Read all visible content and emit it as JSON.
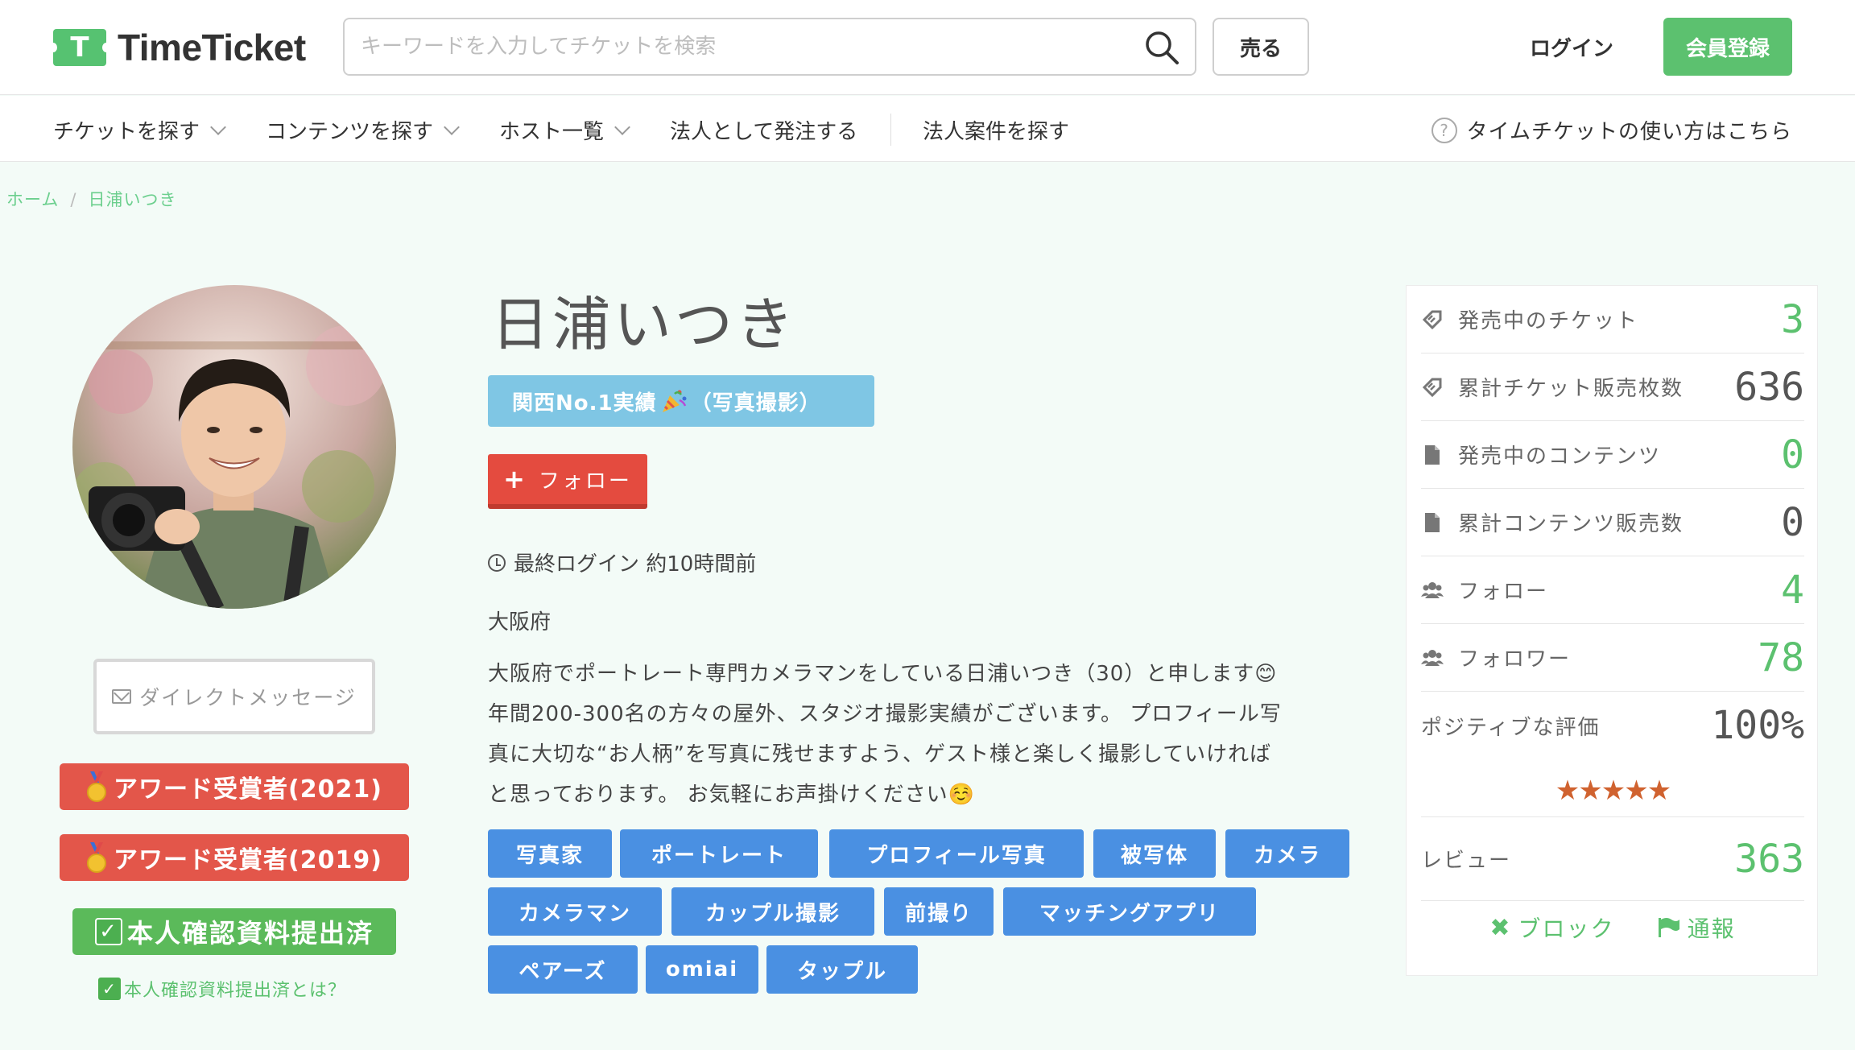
{
  "header": {
    "logo_mark": "T",
    "logo_text": "TimeTicket",
    "search_placeholder": "キーワードを入力してチケットを検索",
    "sell_label": "売る",
    "login_label": "ログイン",
    "register_label": "会員登録",
    "brand_color": "#5cc16f"
  },
  "nav": {
    "items": [
      {
        "label": "チケットを探す",
        "has_dropdown": true
      },
      {
        "label": "コンテンツを探す",
        "has_dropdown": true
      },
      {
        "label": "ホスト一覧",
        "has_dropdown": true
      },
      {
        "label": "法人として発注する",
        "has_dropdown": false
      },
      {
        "label": "法人案件を探す",
        "has_dropdown": false
      }
    ],
    "help_icon_text": "?",
    "help_label": "タイムチケットの使い方はこちら"
  },
  "breadcrumb": {
    "home": "ホーム",
    "separator": "/",
    "current": "日浦いつき"
  },
  "profile": {
    "name": "日浦いつき",
    "catch_before": "関西No.1実績",
    "catch_after": "（写真撮影）",
    "follow_label": "フォロー",
    "last_login": "最終ログイン 約10時間前",
    "location": "大阪府",
    "bio_lines": [
      "大阪府でポートレート専門カメラマンをしている日浦いつき（30）と申します😊",
      "年間200-300名の方々の屋外、スタジオ撮影実績がございます。 プロフィール写",
      "真に大切な“お人柄”を写真に残せますよう、ゲスト様と楽しく撮影していければ",
      "と思っております。 お気軽にお声掛けください☺️"
    ],
    "dm_label": "ダイレクトメッセージ",
    "awards": [
      "アワード受賞者(2021)",
      "アワード受賞者(2019)"
    ],
    "award_color": "#e3564a",
    "verified_label": "本人確認資料提出済",
    "verified_link": "本人確認資料提出済とは？",
    "tags": [
      "写真家",
      "ポートレート",
      "プロフィール写真",
      "被写体",
      "カメラ",
      "カメラマン",
      "カップル撮影",
      "前撮り",
      "マッチングアプリ",
      "ペアーズ",
      "omiai",
      "タップル"
    ],
    "tag_color": "#4a90e2"
  },
  "stats": {
    "rows": [
      {
        "icon": "ticket-icon",
        "label": "発売中のチケット",
        "value": "3",
        "color": "green"
      },
      {
        "icon": "ticket-icon",
        "label": "累計チケット販売枚数",
        "value": "636",
        "color": "gray"
      },
      {
        "icon": "document-icon",
        "label": "発売中のコンテンツ",
        "value": "0",
        "color": "green"
      },
      {
        "icon": "document-icon",
        "label": "累計コンテンツ販売数",
        "value": "0",
        "color": "gray"
      },
      {
        "icon": "users-icon",
        "label": "フォロー",
        "value": "4",
        "color": "green"
      },
      {
        "icon": "users-icon",
        "label": "フォロワー",
        "value": "78",
        "color": "green"
      },
      {
        "icon": "",
        "label": "ポジティブな評価",
        "value": "100%",
        "color": "gray"
      }
    ],
    "rating_stars": 5,
    "stars_text": "★★★★★",
    "review_label": "レビュー",
    "review_count": "363",
    "block_label": "ブロック",
    "report_label": "通報"
  }
}
